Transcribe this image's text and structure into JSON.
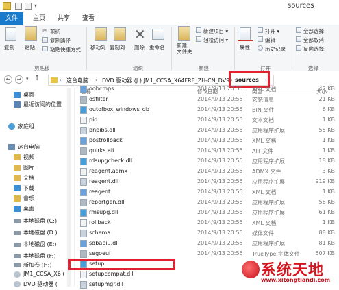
{
  "window": {
    "title": "sources"
  },
  "tabs": [
    {
      "label": "文件",
      "active": true
    },
    {
      "label": "主页"
    },
    {
      "label": "共享"
    },
    {
      "label": "查看"
    }
  ],
  "ribbon": {
    "clipboard": {
      "copy": "复制",
      "paste": "粘贴",
      "cut": "剪切",
      "copy_path": "复制路径",
      "paste_shortcut": "粘贴快捷方式",
      "label": "剪贴板"
    },
    "organize": {
      "move_to": "移动到",
      "copy_to": "复制到",
      "delete": "删除",
      "rename": "重命名",
      "label": "组织"
    },
    "new": {
      "new_folder": "新建\n文件夹",
      "new_item": "新建项目 ▾",
      "easy_access": "轻松访问 ▾",
      "label": "新建"
    },
    "open": {
      "properties": "属性",
      "open": "打开 ▾",
      "edit": "编辑",
      "history": "历史记录",
      "label": "打开"
    },
    "select": {
      "select_all": "全部选择",
      "select_none": "全部取消",
      "invert": "反向选择",
      "label": "选择"
    }
  },
  "address": {
    "crumbs": [
      "这台电脑",
      "DVD 驱动器 (J:) JM1_CCSA_X64FRE_ZH-CN_DV9",
      "sources"
    ],
    "separator": "›"
  },
  "nav": [
    {
      "label": "桌面",
      "icon": "desktop-icon"
    },
    {
      "label": "最近访问的位置",
      "icon": "recent-icon"
    },
    {
      "label": "家庭组",
      "icon": "homegroup-icon"
    },
    {
      "label": "这台电脑",
      "icon": "computer-icon"
    },
    {
      "label": "视频",
      "icon": "video-folder-icon"
    },
    {
      "label": "图片",
      "icon": "pictures-folder-icon"
    },
    {
      "label": "文档",
      "icon": "documents-folder-icon"
    },
    {
      "label": "下载",
      "icon": "downloads-folder-icon"
    },
    {
      "label": "音乐",
      "icon": "music-folder-icon"
    },
    {
      "label": "桌面",
      "icon": "desktop-folder-icon"
    },
    {
      "label": "本地磁盘 (C:)",
      "icon": "drive-icon"
    },
    {
      "label": "本地磁盘 (D:)",
      "icon": "drive-icon"
    },
    {
      "label": "本地磁盘 (E:)",
      "icon": "drive-icon"
    },
    {
      "label": "本地磁盘 (F:)",
      "icon": "drive-icon"
    },
    {
      "label": "新加卷 (H:)",
      "icon": "drive-icon"
    },
    {
      "label": "JM1_CCSA_X6 (",
      "icon": "dvd-icon"
    },
    {
      "label": "DVD 驱动器 (",
      "icon": "dvd-icon"
    }
  ],
  "columns": {
    "name": "名称",
    "date": "修改日期",
    "type": "类型",
    "size": "大小"
  },
  "files": [
    {
      "name": "oobcmps",
      "date": "2014/9/13 20:55",
      "type": "XML 文档",
      "size": "42 KB"
    },
    {
      "name": "osfilter",
      "date": "2014/9/13 20:55",
      "type": "安装信息",
      "size": "21 KB"
    },
    {
      "name": "outofbox_windows_db",
      "date": "2014/9/13 20:55",
      "type": "BIN 文件",
      "size": "6 KB"
    },
    {
      "name": "pid",
      "date": "2014/9/13 20:55",
      "type": "文本文档",
      "size": "1 KB"
    },
    {
      "name": "pnpibs.dll",
      "date": "2014/9/13 20:55",
      "type": "应用程序扩展",
      "size": "55 KB"
    },
    {
      "name": "postrollback",
      "date": "2014/9/13 20:55",
      "type": "XML 文档",
      "size": "1 KB"
    },
    {
      "name": "quirks.ait",
      "date": "2014/9/13 20:55",
      "type": "AIT 文件",
      "size": "1 KB"
    },
    {
      "name": "rdsupgcheck.dll",
      "date": "2014/9/13 20:55",
      "type": "应用程序扩展",
      "size": "18 KB"
    },
    {
      "name": "reagent.admx",
      "date": "2014/9/13 20:55",
      "type": "ADMX 文件",
      "size": "3 KB"
    },
    {
      "name": "reagent.dll",
      "date": "2014/9/13 20:55",
      "type": "应用程序扩展",
      "size": "919 KB"
    },
    {
      "name": "reagent",
      "date": "2014/9/13 20:55",
      "type": "XML 文档",
      "size": "1 KB"
    },
    {
      "name": "reportgen.dll",
      "date": "2014/9/13 20:55",
      "type": "应用程序扩展",
      "size": "56 KB"
    },
    {
      "name": "rmsupg.dll",
      "date": "2014/9/13 20:55",
      "type": "应用程序扩展",
      "size": "61 KB"
    },
    {
      "name": "rollback",
      "date": "2014/9/13 20:55",
      "type": "XML 文档",
      "size": "1 KB"
    },
    {
      "name": "schema",
      "date": "2014/9/13 20:55",
      "type": "媒体文件",
      "size": "88 KB"
    },
    {
      "name": "sdbapiu.dll",
      "date": "2014/9/13 20:55",
      "type": "应用程序扩展",
      "size": "81 KB"
    },
    {
      "name": "segoeui",
      "date": "2014/9/13 20:55",
      "type": "TrueType 字体文件",
      "size": "507 KB"
    },
    {
      "name": "setup",
      "date": "",
      "type": "",
      "size": ""
    },
    {
      "name": "setupcompat.dll",
      "date": "",
      "type": "",
      "size": ""
    },
    {
      "name": "setupmgr.dll",
      "date": "",
      "type": "",
      "size": ""
    }
  ],
  "watermark": {
    "text": "系统天地",
    "url": "www.xitongtiandi.com"
  },
  "colors": {
    "accent": "#1979ca",
    "highlight": "#e3202f",
    "watermark": "#d4141e"
  }
}
